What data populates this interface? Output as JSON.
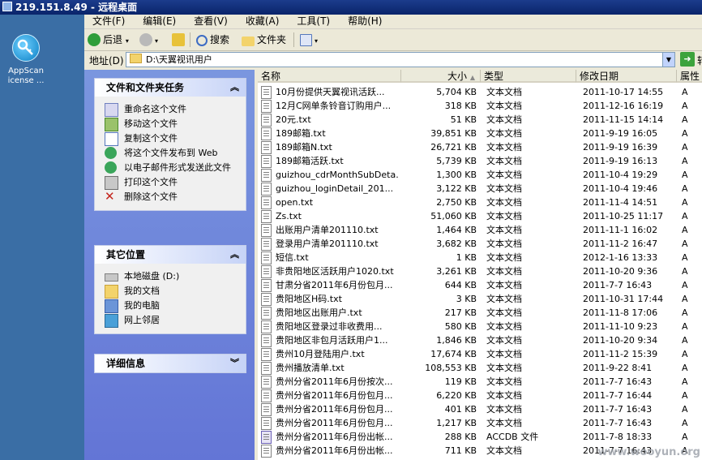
{
  "rdp_title": "219.151.8.49 - 远程桌面",
  "desktop_icon": {
    "label_line1": "AppScan",
    "label_line2": "icense ..."
  },
  "menu": [
    "文件(F)",
    "编辑(E)",
    "查看(V)",
    "收藏(A)",
    "工具(T)",
    "帮助(H)"
  ],
  "toolbar": {
    "back": "后退",
    "search": "搜索",
    "folders": "文件夹"
  },
  "address": {
    "label": "地址(D)",
    "value": "D:\\天翼视讯用户",
    "go": "转"
  },
  "tasks": {
    "file_tasks": {
      "title": "文件和文件夹任务",
      "items": [
        "重命名这个文件",
        "移动这个文件",
        "复制这个文件",
        "将这个文件发布到 Web",
        "以电子邮件形式发送此文件",
        "打印这个文件",
        "删除这个文件"
      ]
    },
    "other_places": {
      "title": "其它位置",
      "items": [
        "本地磁盘 (D:)",
        "我的文档",
        "我的电脑",
        "网上邻居"
      ]
    },
    "details": {
      "title": "详细信息"
    }
  },
  "columns": [
    "名称",
    "大小",
    "类型",
    "修改日期",
    "属性"
  ],
  "files": [
    {
      "name": "10月份提供天翼视讯活跃...",
      "size": "5,704 KB",
      "type": "文本文档",
      "date": "2011-10-17 14:55",
      "attr": "A",
      "icon": "text"
    },
    {
      "name": "12月C网单条铃音订购用户...",
      "size": "318 KB",
      "type": "文本文档",
      "date": "2011-12-16 16:19",
      "attr": "A",
      "icon": "text"
    },
    {
      "name": "20元.txt",
      "size": "51 KB",
      "type": "文本文档",
      "date": "2011-11-15 14:14",
      "attr": "A",
      "icon": "text"
    },
    {
      "name": "189邮箱.txt",
      "size": "39,851 KB",
      "type": "文本文档",
      "date": "2011-9-19 16:05",
      "attr": "A",
      "icon": "text"
    },
    {
      "name": "189邮箱N.txt",
      "size": "26,721 KB",
      "type": "文本文档",
      "date": "2011-9-19 16:39",
      "attr": "A",
      "icon": "text"
    },
    {
      "name": "189邮箱活跃.txt",
      "size": "5,739 KB",
      "type": "文本文档",
      "date": "2011-9-19 16:13",
      "attr": "A",
      "icon": "text"
    },
    {
      "name": "guizhou_cdrMonthSubDeta...",
      "size": "1,300 KB",
      "type": "文本文档",
      "date": "2011-10-4 19:29",
      "attr": "A",
      "icon": "text"
    },
    {
      "name": "guizhou_loginDetail_201...",
      "size": "3,122 KB",
      "type": "文本文档",
      "date": "2011-10-4 19:46",
      "attr": "A",
      "icon": "text"
    },
    {
      "name": "open.txt",
      "size": "2,750 KB",
      "type": "文本文档",
      "date": "2011-11-4 14:51",
      "attr": "A",
      "icon": "text"
    },
    {
      "name": "Zs.txt",
      "size": "51,060 KB",
      "type": "文本文档",
      "date": "2011-10-25 11:17",
      "attr": "A",
      "icon": "text"
    },
    {
      "name": "出账用户清单201110.txt",
      "size": "1,464 KB",
      "type": "文本文档",
      "date": "2011-11-1 16:02",
      "attr": "A",
      "icon": "text"
    },
    {
      "name": "登录用户清单201110.txt",
      "size": "3,682 KB",
      "type": "文本文档",
      "date": "2011-11-2 16:47",
      "attr": "A",
      "icon": "text"
    },
    {
      "name": "短信.txt",
      "size": "1 KB",
      "type": "文本文档",
      "date": "2012-1-16 13:33",
      "attr": "A",
      "icon": "text"
    },
    {
      "name": "非贵阳地区活跃用户1020.txt",
      "size": "3,261 KB",
      "type": "文本文档",
      "date": "2011-10-20 9:36",
      "attr": "A",
      "icon": "text"
    },
    {
      "name": "甘肃分省2011年6月份包月...",
      "size": "644 KB",
      "type": "文本文档",
      "date": "2011-7-7 16:43",
      "attr": "A",
      "icon": "text"
    },
    {
      "name": "贵阳地区H码.txt",
      "size": "3 KB",
      "type": "文本文档",
      "date": "2011-10-31 17:44",
      "attr": "A",
      "icon": "text"
    },
    {
      "name": "贵阳地区出账用户.txt",
      "size": "217 KB",
      "type": "文本文档",
      "date": "2011-11-8 17:06",
      "attr": "A",
      "icon": "text"
    },
    {
      "name": "贵阳地区登录过非收费用...",
      "size": "580 KB",
      "type": "文本文档",
      "date": "2011-11-10 9:23",
      "attr": "A",
      "icon": "text"
    },
    {
      "name": "贵阳地区非包月活跃用户1...",
      "size": "1,846 KB",
      "type": "文本文档",
      "date": "2011-10-20 9:34",
      "attr": "A",
      "icon": "text"
    },
    {
      "name": "贵州10月登陆用户.txt",
      "size": "17,674 KB",
      "type": "文本文档",
      "date": "2011-11-2 15:39",
      "attr": "A",
      "icon": "text"
    },
    {
      "name": "贵州播放清单.txt",
      "size": "108,553 KB",
      "type": "文本文档",
      "date": "2011-9-22 8:41",
      "attr": "A",
      "icon": "text"
    },
    {
      "name": "贵州分省2011年6月份按次...",
      "size": "119 KB",
      "type": "文本文档",
      "date": "2011-7-7 16:43",
      "attr": "A",
      "icon": "text"
    },
    {
      "name": "贵州分省2011年6月份包月...",
      "size": "6,220 KB",
      "type": "文本文档",
      "date": "2011-7-7 16:44",
      "attr": "A",
      "icon": "text"
    },
    {
      "name": "贵州分省2011年6月份包月...",
      "size": "401 KB",
      "type": "文本文档",
      "date": "2011-7-7 16:43",
      "attr": "A",
      "icon": "text"
    },
    {
      "name": "贵州分省2011年6月份包月...",
      "size": "1,217 KB",
      "type": "文本文档",
      "date": "2011-7-7 16:43",
      "attr": "A",
      "icon": "text"
    },
    {
      "name": "贵州分省2011年6月份出帐...",
      "size": "288 KB",
      "type": "ACCDB 文件",
      "date": "2011-7-8 18:33",
      "attr": "A",
      "icon": "db"
    },
    {
      "name": "贵州分省2011年6月份出帐...",
      "size": "711 KB",
      "type": "文本文档",
      "date": "2011-7-7 16:43",
      "attr": "A",
      "icon": "text"
    }
  ],
  "watermark": "www.wooyun.org"
}
